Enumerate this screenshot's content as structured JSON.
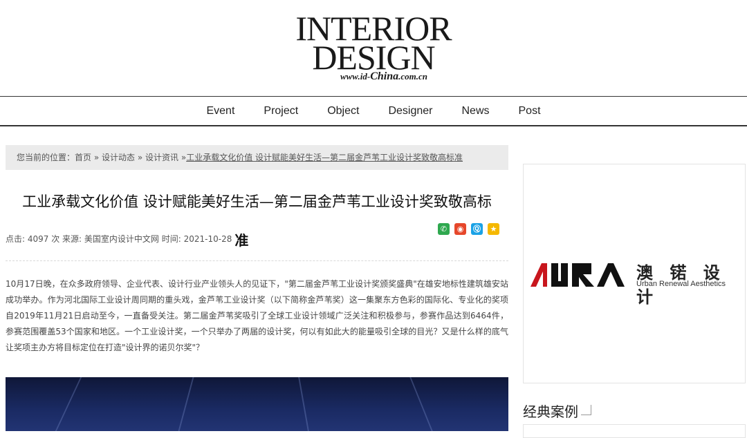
{
  "logo": {
    "line1": "INTERIOR",
    "line2": "DESIGN",
    "url_prefix": "www.id-",
    "url_brand": "China",
    "url_suffix": ".com.cn"
  },
  "nav": {
    "items": [
      "Event",
      "Project",
      "Object",
      "Designer",
      "News",
      "Post"
    ]
  },
  "breadcrumb": {
    "prefix": "您当前的位置：",
    "home": "首页",
    "sep1": " » ",
    "level1": "设计动态",
    "sep2": " » ",
    "level2": "设计资讯",
    "sep3": " »",
    "current": "工业承载文化价值 设计赋能美好生活—第二届金芦苇工业设计奖致敬高标准"
  },
  "article": {
    "title": "工业承载文化价值 设计赋能美好生活—第二届金芦苇工业设计奖致敬高标",
    "meta_clicks_label": "点击: ",
    "meta_clicks": "4097",
    "meta_clicks_unit": " 次 ",
    "meta_source_label": "来源: ",
    "meta_source": "美国室内设计中文网",
    "meta_time_label": " 时间: ",
    "meta_time": "2021-10-28",
    "meta_overflow": "准",
    "paragraph": "10月17日晚，在众多政府领导、企业代表、设计行业产业领头人的见证下，\"第二届金芦苇工业设计奖颁奖盛典\"在雄安地标性建筑雄安站成功举办。作为河北国际工业设计周同期的重头戏，金芦苇工业设计奖（以下简称金芦苇奖）这一集聚东方色彩的国际化、专业化的奖项自2019年11月21日启动至今，一直备受关注。第二届金芦苇奖吸引了全球工业设计领域广泛关注和积极参与，参赛作品达到6464件，参赛范围覆盖53个国家和地区。一个工业设计奖，一个只举办了两届的设计奖，何以有如此大的能量吸引全球的目光？又是什么样的底气让奖项主办方将目标定位在打造\"设计界的诺贝尔奖\"？"
  },
  "share": {
    "icons": [
      "wechat-icon",
      "weibo-icon",
      "qq-icon",
      "qzone-icon"
    ],
    "colors": [
      "#2fa84f",
      "#e6472b",
      "#1aa2e6",
      "#f5b800"
    ]
  },
  "sidebar": {
    "ad_cn": "澳 锘 设 计",
    "ad_en": "Urban Renewal Aesthetics",
    "ad_logo_text": "AURA",
    "ad_logo_color": "#c8161d",
    "section_title": "经典案例"
  }
}
